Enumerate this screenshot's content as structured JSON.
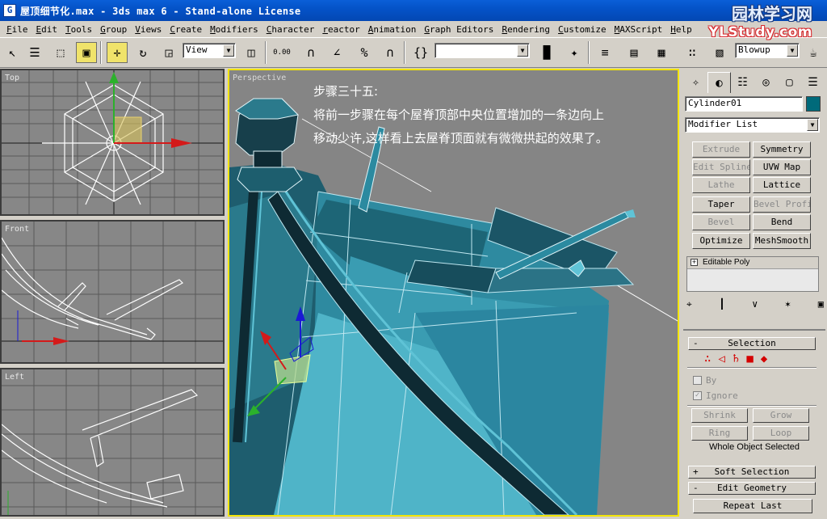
{
  "window": {
    "title": "屋顶细节化.max - 3ds max 6 - Stand-alone License"
  },
  "watermark": {
    "line1": "园林学习网",
    "line2": "YLStudy.com"
  },
  "menu": [
    "File",
    "Edit",
    "Tools",
    "Group",
    "Views",
    "Create",
    "Modifiers",
    "Character",
    "reactor",
    "Animation",
    "Graph Editors",
    "Rendering",
    "Customize",
    "MAXScript",
    "Help"
  ],
  "toolbar": {
    "coord_system": "View",
    "selection_set": "",
    "render_type": "Blowup",
    "snap_value": "0.00"
  },
  "icons": [
    "select-icon",
    "select-by-name-icon",
    "rect-region-icon",
    "window-crossing-icon",
    "move-icon",
    "rotate-icon",
    "scale-icon",
    "pivot-icon",
    "spinner-snap-icon",
    "snap-3d-icon",
    "angle-snap-icon",
    "percent-snap-icon",
    "magnet-snap-icon",
    "named-selection-icon",
    "mirror-icon",
    "align-icon",
    "layers-icon",
    "curve-editor-icon",
    "schematic-icon",
    "material-editor-icon",
    "render-scene-icon",
    "quick-render-icon",
    "teapot-icon"
  ],
  "viewports": {
    "top": "Top",
    "front": "Front",
    "left": "Left",
    "perspective": "Perspective"
  },
  "caption": {
    "line1": "步骤三十五:",
    "line2": "将前一步骤在每个屋脊顶部中央位置增加的一条边向上",
    "line3": "移动少许,这样看上去屋脊顶面就有微微拱起的效果了。"
  },
  "command_panel": {
    "object_name": "Cylinder01",
    "object_color": "#006a7a",
    "modifier_list": "Modifier List",
    "modifier_buttons": [
      {
        "label": "Extrude",
        "enabled": false
      },
      {
        "label": "Symmetry",
        "enabled": true
      },
      {
        "label": "Edit Spline",
        "enabled": false
      },
      {
        "label": "UVW Map",
        "enabled": true
      },
      {
        "label": "Lathe",
        "enabled": false
      },
      {
        "label": "Lattice",
        "enabled": true
      },
      {
        "label": "Taper",
        "enabled": true
      },
      {
        "label": "Bevel Profile",
        "enabled": false
      },
      {
        "label": "Bevel",
        "enabled": false
      },
      {
        "label": "Bend",
        "enabled": true
      },
      {
        "label": "Optimize",
        "enabled": true
      },
      {
        "label": "MeshSmooth",
        "enabled": true
      }
    ],
    "stack_item": "Editable Poly",
    "selection": {
      "header": "Selection",
      "by_label": "By",
      "ignore_label": "Ignore",
      "shrink": "Shrink",
      "grow": "Grow",
      "ring": "Ring",
      "loop": "Loop",
      "status": "Whole Object Selected"
    },
    "soft_selection": "Soft Selection",
    "edit_geometry": "Edit Geometry",
    "repeat_last": "Repeat Last"
  }
}
